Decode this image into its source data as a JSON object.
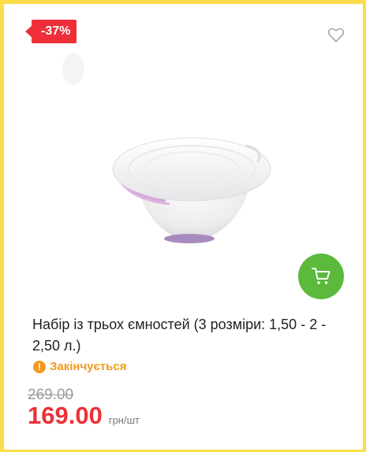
{
  "badge": {
    "discount": "-37%"
  },
  "product": {
    "image_alt": "set of three plastic bowls with lids",
    "title": "Набір із трьох ємностей (3 розміри: 1,50 - 2 - 2,50 л.)",
    "stock_status": "Закінчується",
    "old_price": "269.00",
    "price": "169.00",
    "unit": "грн/шт"
  },
  "icons": {
    "wishlist": "heart-icon",
    "cart": "cart-icon",
    "stock": "exclamation-icon"
  },
  "colors": {
    "page_background": "#fbdd4a",
    "card_background": "#ffffff",
    "discount": "#ee2f39",
    "price": "#ee2f39",
    "cart_button": "#5bb93c",
    "stock_warning": "#f29a1d",
    "old_price": "#9a9a9a"
  }
}
